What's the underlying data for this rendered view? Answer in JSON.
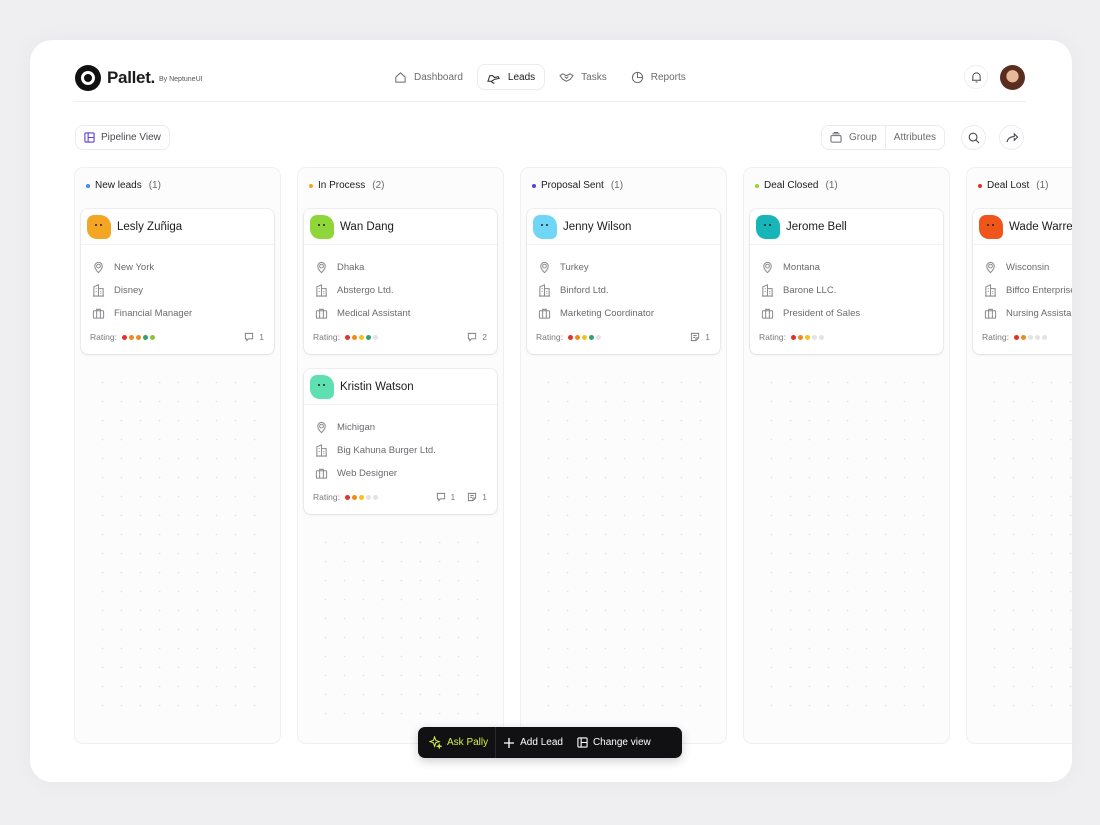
{
  "app": {
    "name": "Pallet.",
    "by": "By NeptuneUI"
  },
  "nav": [
    {
      "label": "Dashboard",
      "icon": "home-icon",
      "active": false
    },
    {
      "label": "Leads",
      "icon": "leads-icon",
      "active": true
    },
    {
      "label": "Tasks",
      "icon": "handshake-icon",
      "active": false
    },
    {
      "label": "Reports",
      "icon": "pie-chart-icon",
      "active": false
    }
  ],
  "toolbar": {
    "pipeline_label": "Pipeline View",
    "group_label": "Group",
    "attributes_label": "Attributes"
  },
  "colors": {
    "red": "#e0312a",
    "orange": "#f08a1c",
    "yellow": "#f2c31a",
    "green": "#2fa36b",
    "lime": "#8bc43a",
    "empty": "#e3e3e6"
  },
  "columns": [
    {
      "title": "New leads",
      "count": "(1)",
      "dot": "#3b8ff0",
      "cards": [
        {
          "name": "Lesly Zuñiga",
          "blob": "#f5a524",
          "location": "New York",
          "company": "Disney",
          "role": "Financial Manager",
          "rating_label": "Rating:",
          "rating": [
            "#e0312a",
            "#f08a1c",
            "#f08a1c",
            "#2fa36b",
            "#8bc43a"
          ],
          "metas": [
            {
              "icon": "comment-icon",
              "count": "1"
            }
          ]
        }
      ]
    },
    {
      "title": "In Process",
      "count": "(2)",
      "dot": "#f5a524",
      "cards": [
        {
          "name": "Wan Dang",
          "blob": "#8fd63a",
          "location": "Dhaka",
          "company": "Abstergo Ltd.",
          "role": "Medical Assistant",
          "rating_label": "Rating:",
          "rating": [
            "#e0312a",
            "#f08a1c",
            "#f2c31a",
            "#2fa36b",
            "#e3e3e6"
          ],
          "metas": [
            {
              "icon": "comment-icon",
              "count": "2"
            }
          ]
        },
        {
          "name": "Kristin Watson",
          "blob": "#5fe0b3",
          "location": "Michigan",
          "company": "Big Kahuna Burger Ltd.",
          "role": "Web Designer",
          "rating_label": "Rating:",
          "rating": [
            "#e0312a",
            "#f08a1c",
            "#f2c31a",
            "#e3e3e6",
            "#e3e3e6"
          ],
          "metas": [
            {
              "icon": "comment-icon",
              "count": "1"
            },
            {
              "icon": "note-icon",
              "count": "1"
            }
          ]
        }
      ]
    },
    {
      "title": "Proposal Sent",
      "count": "(1)",
      "dot": "#5b3fd6",
      "cards": [
        {
          "name": "Jenny Wilson",
          "blob": "#6fd6f5",
          "location": "Turkey",
          "company": "Binford Ltd.",
          "role": "Marketing Coordinator",
          "rating_label": "Rating:",
          "rating": [
            "#e0312a",
            "#f08a1c",
            "#f2c31a",
            "#2fa36b",
            "#e3e3e6"
          ],
          "metas": [
            {
              "icon": "note-icon",
              "count": "1"
            }
          ]
        }
      ]
    },
    {
      "title": "Deal Closed",
      "count": "(1)",
      "dot": "#9bd12e",
      "cards": [
        {
          "name": "Jerome Bell",
          "blob": "#18b5b8",
          "location": "Montana",
          "company": "Barone LLC.",
          "role": "President of Sales",
          "rating_label": "Rating:",
          "rating": [
            "#e0312a",
            "#f08a1c",
            "#f2c31a",
            "#e3e3e6",
            "#e3e3e6"
          ],
          "metas": []
        }
      ]
    },
    {
      "title": "Deal Lost",
      "count": "(1)",
      "dot": "#e0312a",
      "cards": [
        {
          "name": "Wade Warren",
          "blob": "#f0561c",
          "location": "Wisconsin",
          "company": "Biffco Enterprises Ltd.",
          "role": "Nursing Assistant",
          "rating_label": "Rating:",
          "rating": [
            "#e0312a",
            "#f08a1c",
            "#e3e3e6",
            "#e3e3e6",
            "#e3e3e6"
          ],
          "metas": []
        }
      ]
    }
  ],
  "action_bar": {
    "ask_label": "Ask Pally",
    "add_label": "Add Lead",
    "change_label": "Change view"
  }
}
